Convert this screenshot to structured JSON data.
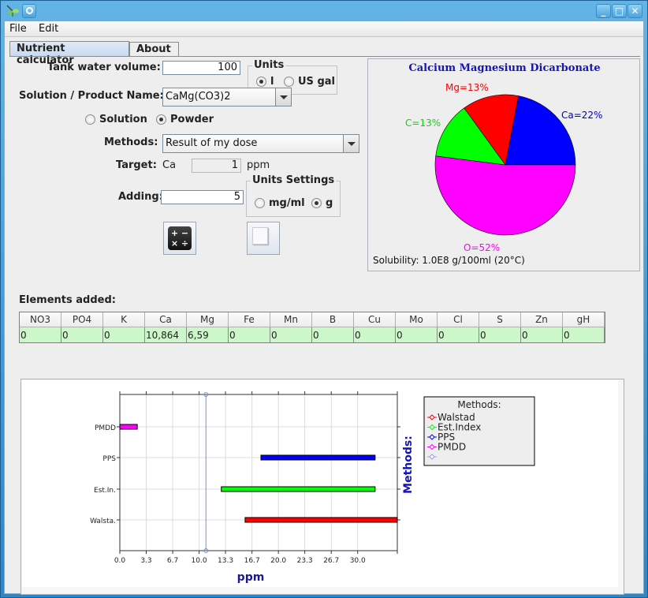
{
  "window": {
    "title": "",
    "controls": {
      "minimize": "_",
      "maximize": "□",
      "close": "✕"
    }
  },
  "menubar": {
    "items": [
      "File",
      "Edit"
    ]
  },
  "tabs": [
    {
      "label": "Nutrient calculator",
      "active": true
    },
    {
      "label": "About",
      "active": false
    }
  ],
  "form": {
    "tank_volume_label": "Tank water volume:",
    "tank_volume_value": "100",
    "units_group": {
      "title": "Units",
      "options": [
        {
          "label": "l",
          "selected": true
        },
        {
          "label": "US gal",
          "selected": false
        }
      ]
    },
    "product_label": "Solution / Product Name:",
    "product_value": "CaMg(CO3)2",
    "form_type": [
      {
        "label": "Solution",
        "selected": false
      },
      {
        "label": "Powder",
        "selected": true
      }
    ],
    "methods_label": "Methods:",
    "methods_value": "Result of my dose",
    "target_label": "Target:",
    "target_element": "Ca",
    "target_value": "1",
    "target_unit": "ppm",
    "adding_label": "Adding:",
    "adding_value": "5",
    "units_settings": {
      "title": "Units Settings",
      "options": [
        {
          "label": "mg/ml",
          "selected": false
        },
        {
          "label": "g",
          "selected": true
        }
      ]
    },
    "calculate_button_icon": "calculator-icon",
    "copy_button_icon": "copy-icon"
  },
  "pie": {
    "title": "Calcium Magnesium Dicarbonate",
    "solubility": "Solubility: 1.0E8 g/100ml (20°C)",
    "slices": [
      {
        "name": "Ca",
        "label": "Ca=22%",
        "percent": 22,
        "color": "#0000ff"
      },
      {
        "name": "Mg",
        "label": "Mg=13%",
        "percent": 13,
        "color": "#ff0000"
      },
      {
        "name": "C",
        "label": "C=13%",
        "percent": 13,
        "color": "#00ff00"
      },
      {
        "name": "O",
        "label": "O=52%",
        "percent": 52,
        "color": "#ff00ff"
      }
    ]
  },
  "elements": {
    "title": "Elements added:",
    "columns": [
      "NO3",
      "PO4",
      "K",
      "Ca",
      "Mg",
      "Fe",
      "Mn",
      "B",
      "Cu",
      "Mo",
      "Cl",
      "S",
      "Zn",
      "gH"
    ],
    "values": [
      "0",
      "0",
      "0",
      "10,864",
      "6,59",
      "0",
      "0",
      "0",
      "0",
      "0",
      "0",
      "0",
      "0",
      "0"
    ]
  },
  "chart_data": {
    "type": "bar",
    "orientation": "horizontal-range",
    "title": "",
    "xlabel": "ppm",
    "ylabel": "Methods:",
    "xlim": [
      0,
      35
    ],
    "xticks": [
      "0.0",
      "3.3",
      "6.7",
      "10.0",
      "13.3",
      "16.7",
      "20.0",
      "23.3",
      "26.7",
      "30.0"
    ],
    "xtick_values": [
      0,
      3.33,
      6.67,
      10,
      13.33,
      16.67,
      20,
      23.33,
      26.67,
      30
    ],
    "grid": true,
    "categories": [
      "Walsta.",
      "Est.In.",
      "PPS",
      "PMDD"
    ],
    "series": [
      {
        "name": "Walstad",
        "category": "Walsta.",
        "start": 15.8,
        "end": 35.0,
        "color": "#ff0000"
      },
      {
        "name": "Est.Index",
        "category": "Est.In.",
        "start": 12.8,
        "end": 32.2,
        "color": "#00ff00"
      },
      {
        "name": "PPS",
        "category": "PPS",
        "start": 17.8,
        "end": 32.2,
        "color": "#0000ff"
      },
      {
        "name": "PMDD",
        "category": "PMDD",
        "start": 0.0,
        "end": 2.2,
        "color": "#ff00ff"
      }
    ],
    "marker_value": 10.864,
    "marker_color": "#6f94d8",
    "legend": {
      "title": "Methods:",
      "placement": "right",
      "entries": [
        {
          "label": "Walstad",
          "color": "#ff0000"
        },
        {
          "label": "Est.Index",
          "color": "#00ff00"
        },
        {
          "label": "PPS",
          "color": "#0000ff"
        },
        {
          "label": "PMDD",
          "color": "#ff00ff"
        },
        {
          "label": "",
          "color": "#9999ee"
        }
      ]
    }
  }
}
